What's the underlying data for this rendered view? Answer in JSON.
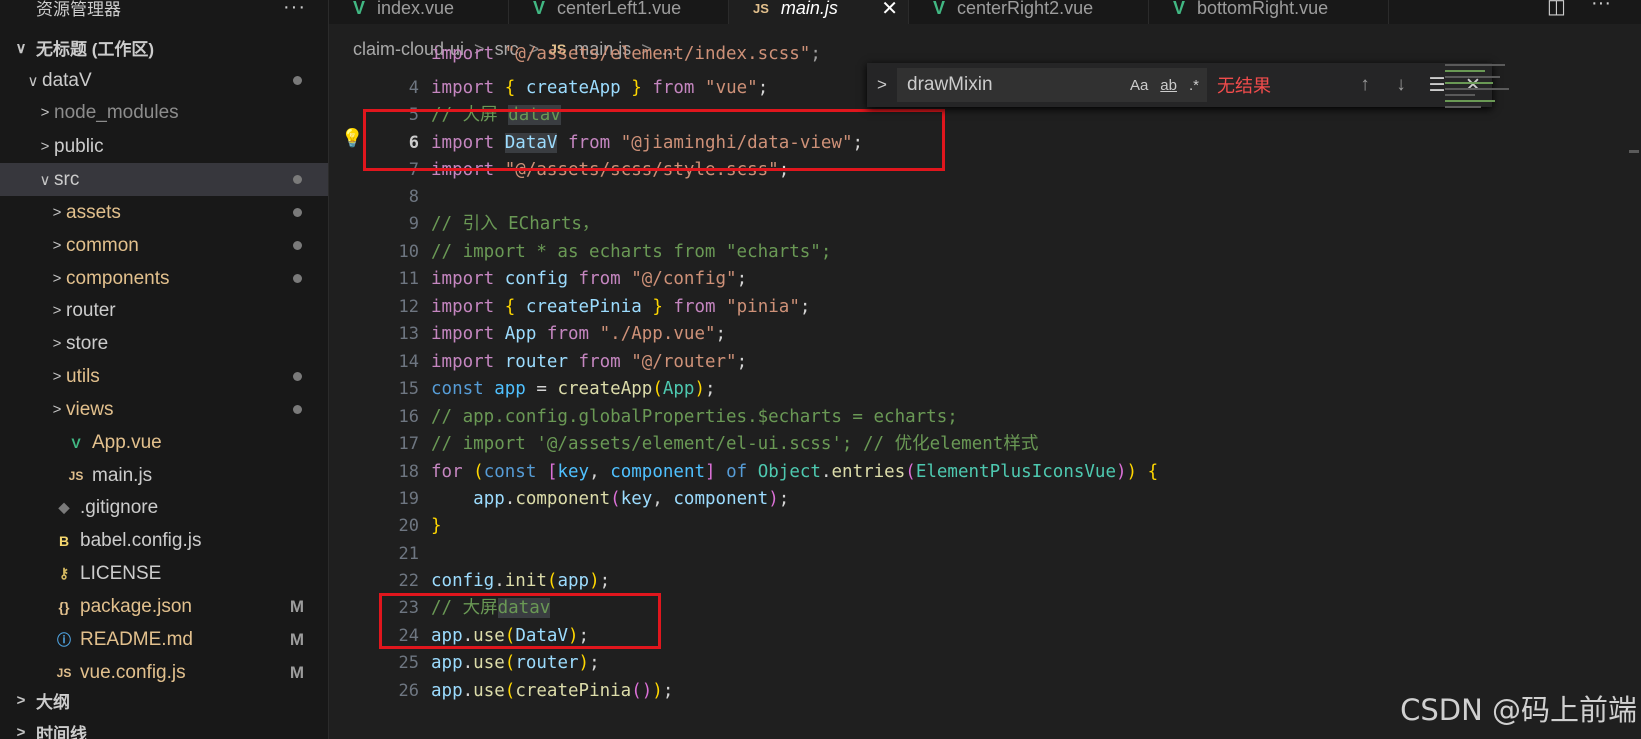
{
  "sidebar": {
    "title": "资源管理器",
    "more": "···",
    "workspace": "无标题 (工作区)",
    "items": [
      {
        "label": "dataV",
        "chev": "∨",
        "icon": "",
        "color": "#cccccc",
        "badge": "dot"
      },
      {
        "label": "node_modules",
        "chev": ">",
        "icon": "",
        "color": "#8c8c8c",
        "badge": ""
      },
      {
        "label": "public",
        "chev": ">",
        "icon": "",
        "color": "#cccccc",
        "badge": ""
      },
      {
        "label": "src",
        "chev": "∨",
        "icon": "",
        "color": "#cccccc",
        "badge": "dot"
      },
      {
        "label": "assets",
        "chev": ">",
        "icon": "",
        "color": "#e2c08d",
        "badge": "dot"
      },
      {
        "label": "common",
        "chev": ">",
        "icon": "",
        "color": "#e2c08d",
        "badge": "dot"
      },
      {
        "label": "components",
        "chev": ">",
        "icon": "",
        "color": "#e2c08d",
        "badge": "dot"
      },
      {
        "label": "router",
        "chev": ">",
        "icon": "",
        "color": "#cccccc",
        "badge": ""
      },
      {
        "label": "store",
        "chev": ">",
        "icon": "",
        "color": "#cccccc",
        "badge": ""
      },
      {
        "label": "utils",
        "chev": ">",
        "icon": "",
        "color": "#e2c08d",
        "badge": "dot"
      },
      {
        "label": "views",
        "chev": ">",
        "icon": "",
        "color": "#e2c08d",
        "badge": "dot"
      },
      {
        "label": "App.vue",
        "chev": "",
        "icon": "V",
        "color": "#e2c08d",
        "badge": ""
      },
      {
        "label": "main.js",
        "chev": "",
        "icon": "JS",
        "color": "#cccccc",
        "badge": ""
      },
      {
        "label": ".gitignore",
        "chev": "",
        "icon": "◆",
        "color": "#cccccc",
        "badge": ""
      },
      {
        "label": "babel.config.js",
        "chev": "",
        "icon": "B",
        "color": "#cccccc",
        "badge": ""
      },
      {
        "label": "LICENSE",
        "chev": "",
        "icon": "⚷",
        "color": "#cccccc",
        "badge": ""
      },
      {
        "label": "package.json",
        "chev": "",
        "icon": "{}",
        "color": "#e2c08d",
        "badge": "M"
      },
      {
        "label": "README.md",
        "chev": "",
        "icon": "ⓘ",
        "color": "#e2c08d",
        "badge": "M"
      },
      {
        "label": "vue.config.js",
        "chev": "",
        "icon": "JS",
        "color": "#e2c08d",
        "badge": "M"
      }
    ],
    "outline": "大纲",
    "timeline": "时间线"
  },
  "tabs": [
    {
      "label": "index.vue",
      "icon": "V"
    },
    {
      "label": "centerLeft1.vue",
      "icon": "V"
    },
    {
      "label": "main.js",
      "icon": "JS",
      "active": true
    },
    {
      "label": "centerRight2.vue",
      "icon": "V"
    },
    {
      "label": "bottomRight.vue",
      "icon": "V"
    }
  ],
  "breadcrumb": [
    "claim-cloud-ui",
    "src",
    "main.js",
    "..."
  ],
  "find": {
    "query": "drawMixin",
    "case": "Aa",
    "word": "ab",
    "regex": ".*",
    "status": "无结果"
  },
  "line_numbers": [
    "4",
    "5",
    "6",
    "7",
    "8",
    "9",
    "10",
    "11",
    "12",
    "13",
    "14",
    "15",
    "16",
    "17",
    "18",
    "19",
    "20",
    "21",
    "22",
    "23",
    "24",
    "25",
    "26"
  ],
  "watermark": "CSDN @码上前端",
  "colors": {
    "accent": "#0078d4",
    "highlight_box": "#e0161d"
  }
}
